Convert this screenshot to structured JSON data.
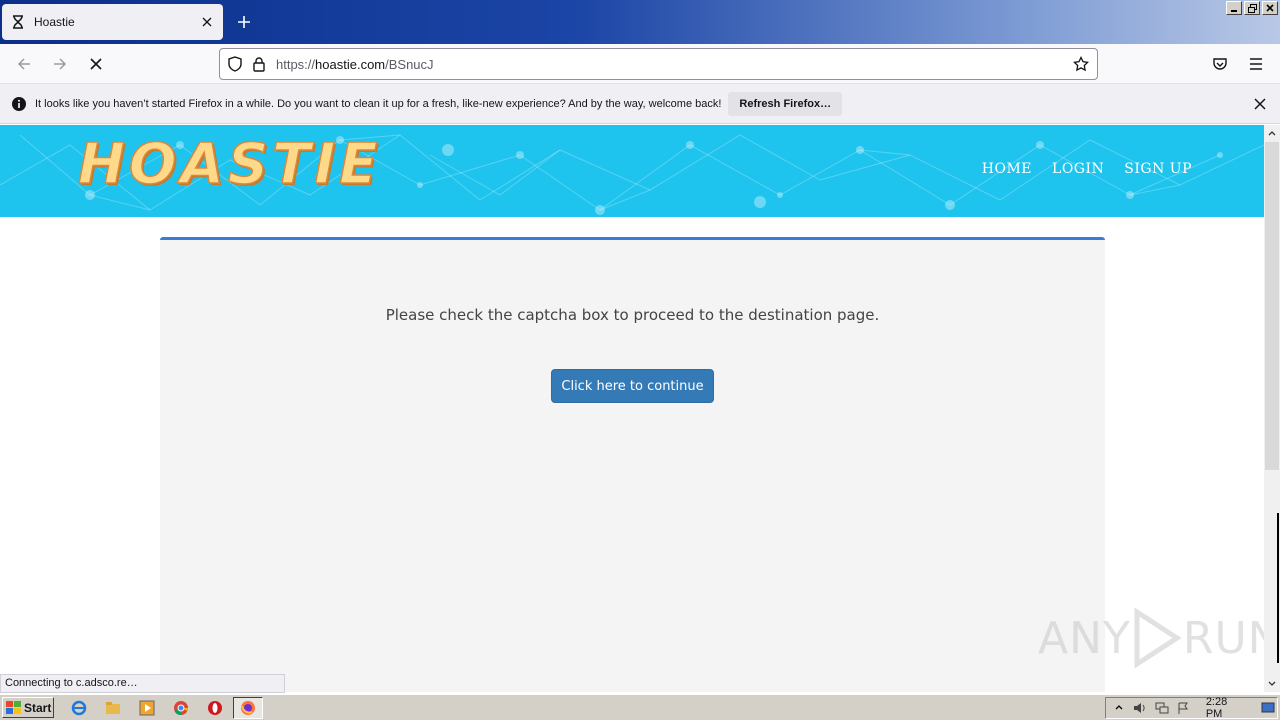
{
  "browser": {
    "tab_title": "Hoastie",
    "url_prefix": "https://",
    "url_host": "hoastie.com",
    "url_path": "/BSnucJ",
    "notification_message": "It looks like you haven’t started Firefox in a while. Do you want to clean it up for a fresh, like-new experience? And by the way, welcome back!",
    "notification_button": "Refresh Firefox…",
    "status_text": "Connecting to c.adsco.re…"
  },
  "site": {
    "logo_text": "HOASTIE",
    "nav": [
      "HOME",
      "LOGIN",
      "SIGN UP"
    ],
    "message": "Please check the captcha box to proceed to the destination page.",
    "button_label": "Click here to continue",
    "accent_color": "#1ec4ee",
    "button_color": "#337ab7"
  },
  "watermark": {
    "left": "ANY",
    "right": "RUN"
  },
  "taskbar": {
    "start_label": "Start",
    "clock": "2:28 PM"
  }
}
